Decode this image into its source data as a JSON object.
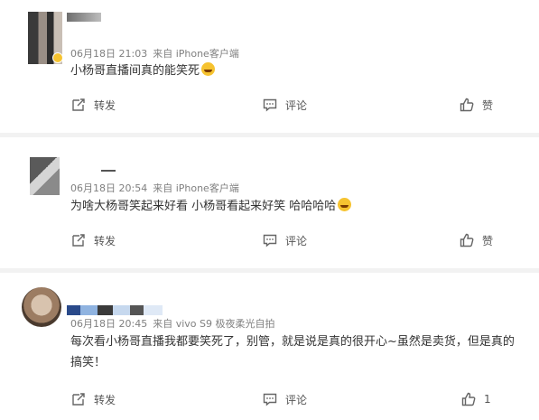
{
  "colors": {
    "meta_gray": "#808080",
    "text": "#333333",
    "separator": "#f2f2f2",
    "badge": "#f6c330"
  },
  "comments": [
    {
      "time": "06月18日 21:03",
      "source": "来自 iPhone客户端",
      "text": "小杨哥直播间真的能笑死",
      "emoji": "laugh-emoji",
      "actions": {
        "forward": "转发",
        "comment": "评论",
        "like": "赞"
      }
    },
    {
      "time": "06月18日 20:54",
      "source": "来自 iPhone客户端",
      "text": "为啥大杨哥笑起来好看 小杨哥看起来好笑 哈哈哈哈",
      "emoji": "laugh-emoji",
      "actions": {
        "forward": "转发",
        "comment": "评论",
        "like": "赞"
      }
    },
    {
      "time": "06月18日 20:45",
      "source": "来自 vivo S9 极夜柔光自拍",
      "text": "每次看小杨哥直播我都要笑死了，别管，就是说是真的很开心~虽然是卖货，但是真的",
      "text_line2": "搞笑！",
      "actions": {
        "forward": "转发",
        "comment": "评论",
        "like": "1"
      }
    }
  ]
}
